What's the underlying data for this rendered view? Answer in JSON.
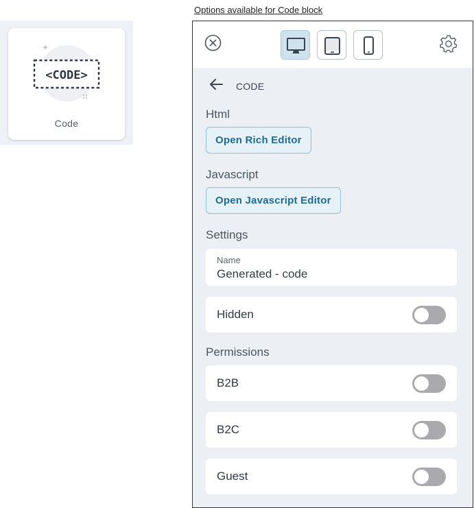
{
  "caption": "Options available for Code block",
  "tile": {
    "icon": "code-tag-icon",
    "art_text": "<CODE>",
    "label": "Code"
  },
  "panel": {
    "topbar": {
      "close_icon": "close-circle-icon",
      "device_buttons": [
        {
          "icon": "desktop-icon",
          "active": true
        },
        {
          "icon": "tablet-icon",
          "active": false
        },
        {
          "icon": "mobile-icon",
          "active": false
        }
      ],
      "settings_icon": "gear-icon"
    },
    "back": {
      "icon": "arrow-left-icon",
      "label": "CODE"
    },
    "html": {
      "label": "Html",
      "button": "Open Rich Editor"
    },
    "javascript": {
      "label": "Javascript",
      "button": "Open Javascript Editor"
    },
    "settings": {
      "label": "Settings",
      "name_label": "Name",
      "name_value": "Generated - code",
      "hidden_label": "Hidden",
      "hidden_on": false
    },
    "permissions": {
      "label": "Permissions",
      "items": [
        {
          "label": "B2B",
          "on": false
        },
        {
          "label": "B2C",
          "on": false
        },
        {
          "label": "Guest",
          "on": false
        }
      ]
    },
    "colors": {
      "accent": "#1f6a99",
      "active_device_bg": "#cfe3ee",
      "panel_bg": "#eceff3",
      "toggle_off": "#aaa9ae"
    }
  }
}
